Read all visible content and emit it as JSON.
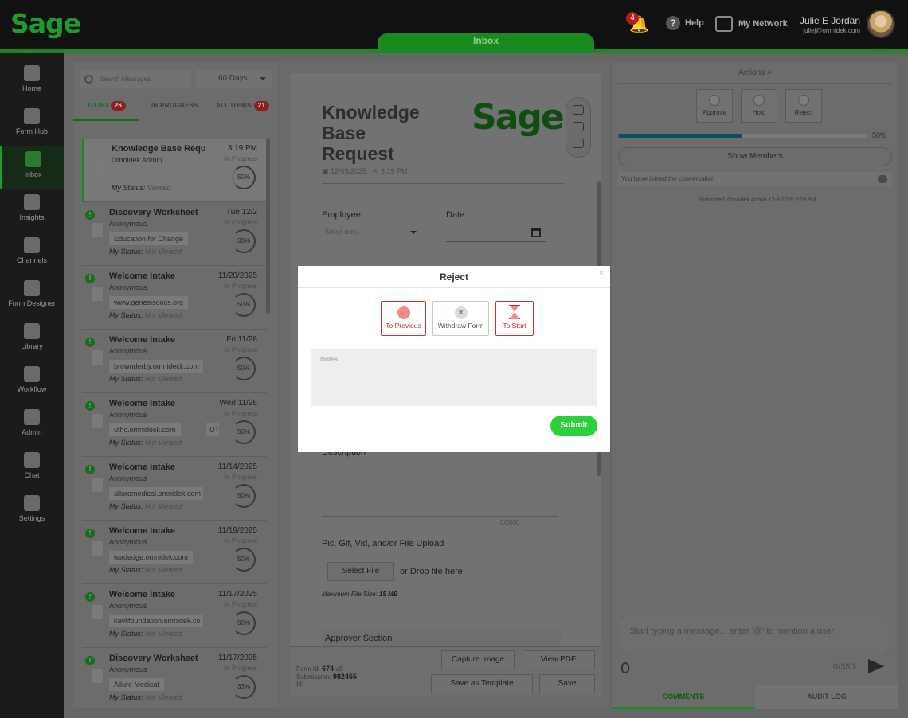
{
  "app": {
    "logo": "Sage",
    "current_tab": "Inbox"
  },
  "header": {
    "notifications_count": "4",
    "help_label": "Help",
    "network_label": "My Network",
    "user_name": "Julie E Jordan",
    "user_email": "juliej@omnidek.com"
  },
  "sidebar": {
    "items": [
      {
        "label": "Home",
        "icon": "home-icon"
      },
      {
        "label": "Form Hub",
        "icon": "form-hub-icon"
      },
      {
        "label": "Inbox",
        "icon": "inbox-icon",
        "active": true
      },
      {
        "label": "Insights",
        "icon": "insights-icon"
      },
      {
        "label": "Channels",
        "icon": "channels-icon"
      },
      {
        "label": "Form Designer",
        "icon": "form-designer-icon"
      },
      {
        "label": "Library",
        "icon": "library-icon"
      },
      {
        "label": "Workflow",
        "icon": "workflow-icon"
      },
      {
        "label": "Admin",
        "icon": "admin-icon"
      },
      {
        "label": "Chat",
        "icon": "chat-icon"
      },
      {
        "label": "Settings",
        "icon": "settings-icon"
      }
    ]
  },
  "list_panel": {
    "search_placeholder": "Search Messages",
    "range": "60 Days",
    "tabs": [
      {
        "label": "TO DO",
        "count": "26",
        "active": true
      },
      {
        "label": "IN PROGRESS",
        "count": ""
      },
      {
        "label": "ALL ITEMS",
        "count": "21"
      }
    ],
    "status_label": "My Status:",
    "items": [
      {
        "title": "Knowledge Base Requ",
        "sub": "Omnidek Admin",
        "chip": "",
        "chip2": "",
        "status": "Viewed",
        "date": "3:19 PM",
        "prog": "In Progress",
        "pct": "50%",
        "selected": true
      },
      {
        "title": "Discovery Worksheet",
        "sub": "Anonymous",
        "chip": "Education for Change",
        "chip2": "",
        "status": "Not Viewed",
        "date": "Tue 12/2",
        "prog": "In Progress",
        "pct": "33%"
      },
      {
        "title": "Welcome Intake",
        "sub": "Anonymous",
        "chip": "www.genesisdocs.org",
        "chip2": "",
        "status": "Not Viewed",
        "date": "11/20/2025",
        "prog": "In Progress",
        "pct": "50%"
      },
      {
        "title": "Welcome Intake",
        "sub": "Anonymous",
        "chip": "brownderby.omnideck.com",
        "chip2": "",
        "status": "Not Viewed",
        "date": "Fri 11/28",
        "prog": "In Progress",
        "pct": "50%"
      },
      {
        "title": "Welcome Intake",
        "sub": "Anonymous",
        "chip": "uthc.omnidesk.com",
        "chip2": "UT",
        "status": "Not Viewed",
        "date": "Wed 11/26",
        "prog": "In Progress",
        "pct": "50%"
      },
      {
        "title": "Welcome Intake",
        "sub": "Anonymous",
        "chip": "alluremedical.omnidek.com",
        "chip2": "",
        "status": "Not Viewed",
        "date": "11/14/2025",
        "prog": "In Progress",
        "pct": "50%"
      },
      {
        "title": "Welcome Intake",
        "sub": "Anonymous",
        "chip": "leadedge.omnidek.com",
        "chip2": "",
        "status": "Not Viewed",
        "date": "11/19/2025",
        "prog": "In Progress",
        "pct": "50%"
      },
      {
        "title": "Welcome Intake",
        "sub": "Anonymous",
        "chip": "kavlifoundation.omnidek.co",
        "chip2": "",
        "status": "Not Viewed",
        "date": "11/17/2025",
        "prog": "In Progress",
        "pct": "50%"
      },
      {
        "title": "Discovery Worksheet",
        "sub": "Anonymous",
        "chip": "Allure Medical",
        "chip2": "",
        "status": "Not Viewed",
        "date": "11/17/2025",
        "prog": "In Progress",
        "pct": "33%"
      }
    ]
  },
  "form": {
    "title": "Knowledge Base Request",
    "logo": "Sage",
    "date": "12/03/2025",
    "time": "3:19 PM",
    "employee_label": "Employee",
    "employee_placeholder": "Select item...",
    "date_label": "Date",
    "description_label": "Description",
    "char_count": "0/2000",
    "upload_label": "Pic, Gif, Vid, and/or File Upload",
    "select_file": "Select File",
    "drop_text": "or Drop file here",
    "max_size_label": "Maximum File Size:",
    "max_size_value": "15 MB",
    "approver_section": "Approver Section",
    "form_id_label": "Form Id:",
    "form_id": "674",
    "form_id_suffix": "v3",
    "submission_label": "Submission:",
    "submission_id": "982455",
    "id_label": "Id:",
    "buttons": {
      "capture": "Capture Image",
      "view_pdf": "View PDF",
      "save_template": "Save as Template",
      "save": "Save"
    }
  },
  "right_panel": {
    "actions_label": "Actions",
    "actions": [
      {
        "label": "Approve",
        "icon": "approve-icon"
      },
      {
        "label": "Hold",
        "icon": "hold-icon"
      },
      {
        "label": "Reject",
        "icon": "reject-icon"
      }
    ],
    "progress_pct": "50%",
    "progress_value": 0.5,
    "show_members": "Show Members",
    "joined_text": "You have joined the conversation",
    "submitted_text": "Submitted: Omnidek Admin 12-3-2025 3:19 PM",
    "message_placeholder": "Start typing a message... enter '@' to mention a user",
    "char_count": "0/350",
    "tabs": [
      {
        "label": "COMMENTS",
        "active": true
      },
      {
        "label": "AUDIT LOG"
      }
    ]
  },
  "modal": {
    "title": "Reject",
    "close_glyph": "×",
    "options": [
      {
        "label": "To Previous",
        "style": "red",
        "icon": "arrow-left-icon"
      },
      {
        "label": "Withdraw Form",
        "style": "grey",
        "icon": "x-circle-icon"
      },
      {
        "label": "To Start",
        "style": "red",
        "icon": "hourglass-icon"
      }
    ],
    "notes_placeholder": "Notes...",
    "submit_label": "Submit",
    "colors": {
      "accent": "#2dd23a",
      "danger": "#d32f2f"
    }
  }
}
